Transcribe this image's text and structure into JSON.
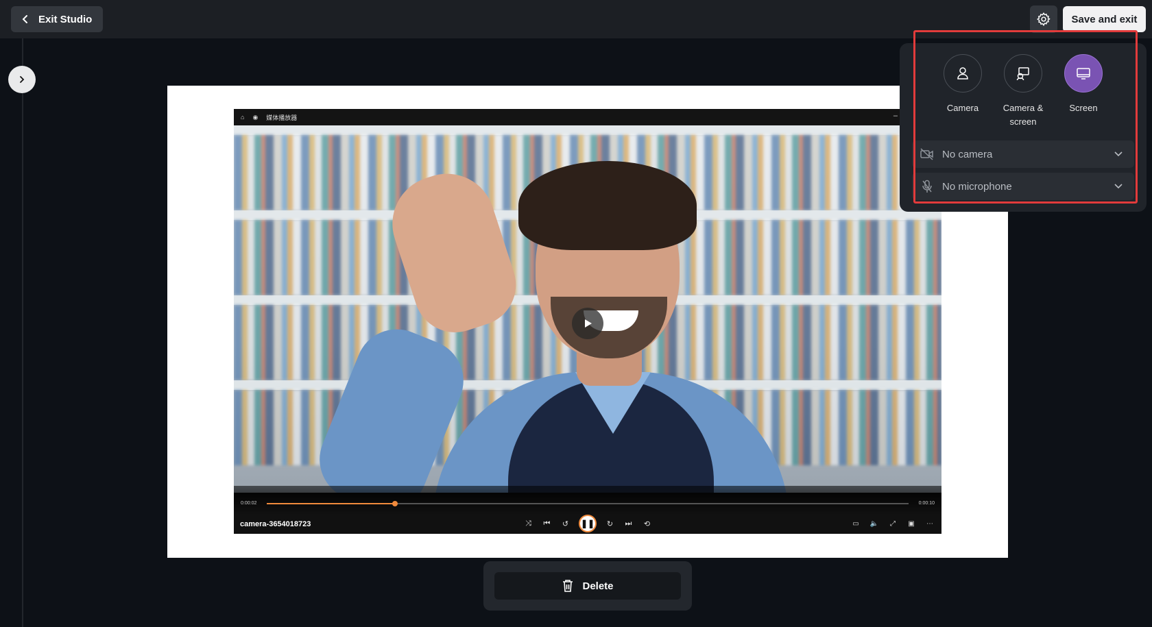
{
  "header": {
    "exit_label": "Exit Studio",
    "save_label": "Save and exit"
  },
  "player": {
    "app_title": "媒体播放器",
    "file_name": "camera-3654018723",
    "current_time": "0:00:02",
    "total_time": "0:00:10",
    "progress": 0.2
  },
  "actions": {
    "delete_label": "Delete"
  },
  "recording_panel": {
    "modes": [
      {
        "label": "Camera",
        "icon": "person-icon",
        "active": false
      },
      {
        "label": "Camera & screen",
        "icon": "camera-screen-icon",
        "active": false
      },
      {
        "label": "Screen",
        "icon": "monitor-icon",
        "active": true
      }
    ],
    "camera_select": "No camera",
    "microphone_select": "No microphone"
  },
  "colors": {
    "accent_purple": "#7a53b3",
    "progress_orange": "#f08a3c",
    "highlight_red": "#e23b3b"
  }
}
